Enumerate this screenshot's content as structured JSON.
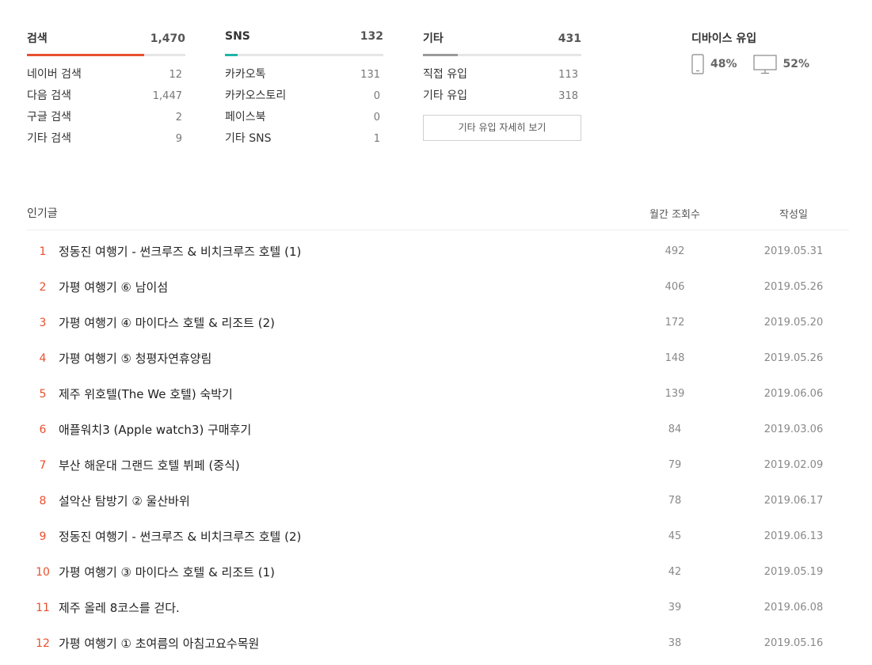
{
  "colors": {
    "search_bar": "#e8502f",
    "sns_bar": "#1fb5a8",
    "etc_bar": "#9a9a9a",
    "rank": "#e8502f"
  },
  "stats": {
    "search": {
      "title": "검색",
      "total": "1,470",
      "share": 0.74,
      "rows": [
        {
          "label": "네이버 검색",
          "value": "12"
        },
        {
          "label": "다음 검색",
          "value": "1,447"
        },
        {
          "label": "구글 검색",
          "value": "2"
        },
        {
          "label": "기타 검색",
          "value": "9"
        }
      ]
    },
    "sns": {
      "title": "SNS",
      "total": "132",
      "share": 0.08,
      "rows": [
        {
          "label": "카카오톡",
          "value": "131"
        },
        {
          "label": "카카오스토리",
          "value": "0"
        },
        {
          "label": "페이스북",
          "value": "0"
        },
        {
          "label": "기타 SNS",
          "value": "1"
        }
      ]
    },
    "etc": {
      "title": "기타",
      "total": "431",
      "share": 0.22,
      "rows": [
        {
          "label": "직접 유입",
          "value": "113"
        },
        {
          "label": "기타 유입",
          "value": "318"
        }
      ],
      "detail_button": "기타 유입 자세히 보기"
    }
  },
  "device": {
    "title": "디바이스 유입",
    "mobile_icon": "mobile-phone-icon",
    "mobile_pct": "48%",
    "desktop_icon": "desktop-monitor-icon",
    "desktop_pct": "52%"
  },
  "popular": {
    "header": {
      "title": "인기글",
      "views": "월간 조회수",
      "date": "작성일"
    },
    "items": [
      {
        "rank": "1",
        "title": "정동진 여행기 - 썬크루즈 & 비치크루즈 호텔 (1)",
        "views": "492",
        "date": "2019.05.31"
      },
      {
        "rank": "2",
        "title": "가평 여행기 ⑥ 남이섬",
        "views": "406",
        "date": "2019.05.26"
      },
      {
        "rank": "3",
        "title": "가평 여행기 ④ 마이다스 호텔 & 리조트 (2)",
        "views": "172",
        "date": "2019.05.20"
      },
      {
        "rank": "4",
        "title": "가평 여행기 ⑤ 청평자연휴양림",
        "views": "148",
        "date": "2019.05.26"
      },
      {
        "rank": "5",
        "title": "제주 위호텔(The We 호텔) 숙박기",
        "views": "139",
        "date": "2019.06.06"
      },
      {
        "rank": "6",
        "title": "애플워치3 (Apple watch3) 구매후기",
        "views": "84",
        "date": "2019.03.06"
      },
      {
        "rank": "7",
        "title": "부산 해운대 그랜드 호텔 뷔페 (중식)",
        "views": "79",
        "date": "2019.02.09"
      },
      {
        "rank": "8",
        "title": "설악산 탐방기 ② 울산바위",
        "views": "78",
        "date": "2019.06.17"
      },
      {
        "rank": "9",
        "title": "정동진 여행기 - 썬크루즈 & 비치크루즈 호텔 (2)",
        "views": "45",
        "date": "2019.06.13"
      },
      {
        "rank": "10",
        "title": "가평 여행기 ③ 마이다스 호텔 & 리조트 (1)",
        "views": "42",
        "date": "2019.05.19"
      },
      {
        "rank": "11",
        "title": "제주 올레 8코스를 걷다.",
        "views": "39",
        "date": "2019.06.08"
      },
      {
        "rank": "12",
        "title": "가평 여행기 ① 초여름의 아침고요수목원",
        "views": "38",
        "date": "2019.05.16"
      }
    ]
  }
}
